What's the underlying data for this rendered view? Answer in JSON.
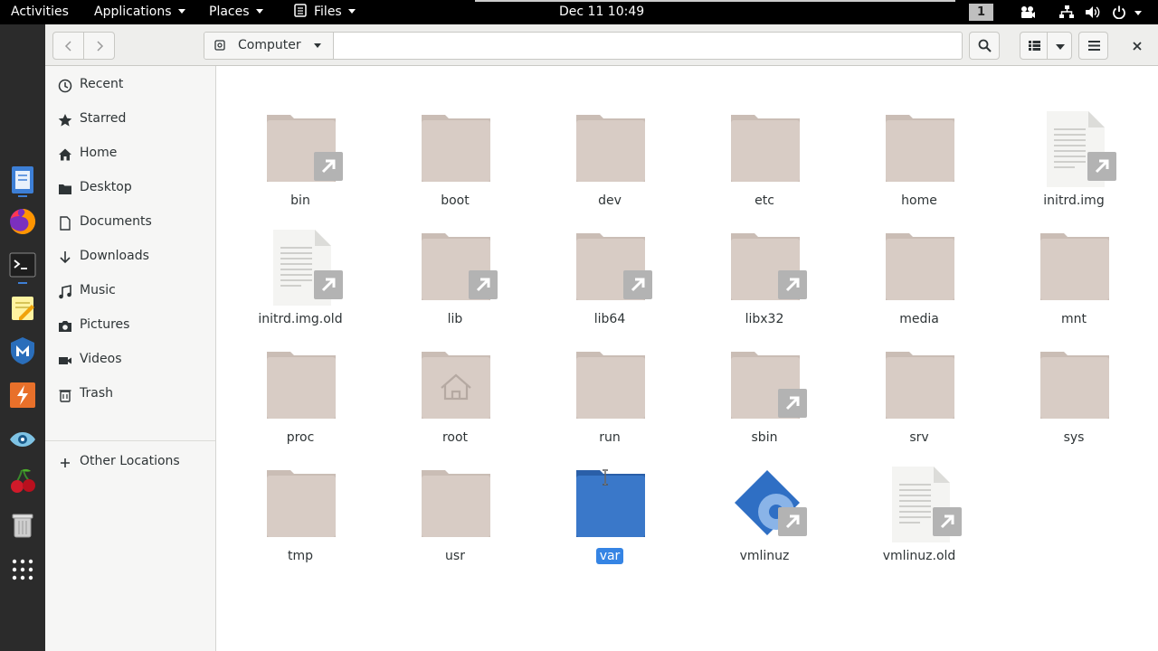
{
  "topbar": {
    "activities": "Activities",
    "applications": "Applications",
    "places": "Places",
    "files_menu": "Files",
    "clock": "Dec 11  10:49",
    "workspace": "1"
  },
  "dock": {
    "apps": [
      {
        "name": "files-icon",
        "active": true
      },
      {
        "name": "firefox-icon",
        "active": false
      },
      {
        "name": "terminal-icon",
        "active": true
      },
      {
        "name": "text-editor-icon",
        "active": false
      },
      {
        "name": "metasploit-icon",
        "active": false
      },
      {
        "name": "burp-suite-icon",
        "active": false
      },
      {
        "name": "eye-app-icon",
        "active": false
      },
      {
        "name": "cherry-app-icon",
        "active": false
      },
      {
        "name": "trash-icon",
        "active": false
      },
      {
        "name": "show-apps-icon",
        "active": false
      }
    ]
  },
  "headerbar": {
    "location": "Computer"
  },
  "sidebar": {
    "items": [
      {
        "label": "Recent",
        "icon": "clock-icon"
      },
      {
        "label": "Starred",
        "icon": "star-icon"
      },
      {
        "label": "Home",
        "icon": "home-icon"
      },
      {
        "label": "Desktop",
        "icon": "folder-icon"
      },
      {
        "label": "Documents",
        "icon": "document-icon"
      },
      {
        "label": "Downloads",
        "icon": "download-arrow-icon"
      },
      {
        "label": "Music",
        "icon": "music-note-icon"
      },
      {
        "label": "Pictures",
        "icon": "camera-icon"
      },
      {
        "label": "Videos",
        "icon": "video-icon"
      },
      {
        "label": "Trash",
        "icon": "trash-icon"
      }
    ],
    "other_locations": "Other Locations"
  },
  "files": [
    {
      "name": "bin",
      "type": "folder-link"
    },
    {
      "name": "boot",
      "type": "folder"
    },
    {
      "name": "dev",
      "type": "folder"
    },
    {
      "name": "etc",
      "type": "folder"
    },
    {
      "name": "home",
      "type": "folder"
    },
    {
      "name": "initrd.img",
      "type": "file-link"
    },
    {
      "name": "initrd.img.old",
      "type": "file-link"
    },
    {
      "name": "lib",
      "type": "folder-link"
    },
    {
      "name": "lib64",
      "type": "folder-link"
    },
    {
      "name": "libx32",
      "type": "folder-link"
    },
    {
      "name": "media",
      "type": "folder"
    },
    {
      "name": "mnt",
      "type": "folder"
    },
    {
      "name": "proc",
      "type": "folder"
    },
    {
      "name": "root",
      "type": "folder-home"
    },
    {
      "name": "run",
      "type": "folder"
    },
    {
      "name": "sbin",
      "type": "folder-link"
    },
    {
      "name": "srv",
      "type": "folder"
    },
    {
      "name": "sys",
      "type": "folder"
    },
    {
      "name": "tmp",
      "type": "folder"
    },
    {
      "name": "usr",
      "type": "folder"
    },
    {
      "name": "var",
      "type": "folder",
      "selected": true
    },
    {
      "name": "vmlinuz",
      "type": "executable-link"
    },
    {
      "name": "vmlinuz.old",
      "type": "file-link"
    }
  ],
  "colors": {
    "folder": "#d8ccc5",
    "folder_tab": "#cabdb5",
    "selected_folder": "#3a78c9",
    "selection": "#3584e4",
    "link_badge": "#b3b3b3"
  }
}
